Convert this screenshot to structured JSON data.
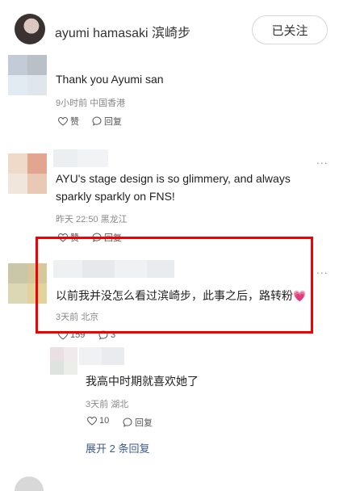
{
  "header": {
    "username": "ayumi hamasaki 滨崎步",
    "follow_label": "已关注"
  },
  "comments": [
    {
      "text": "Thank you Ayumi san",
      "time": "9小时前",
      "location": "中国香港",
      "like_label": "赞",
      "reply_label": "回复"
    },
    {
      "text": "AYU's stage design is so glimmery, and always sparkly sparkly on FNS!",
      "time": "昨天 22:50",
      "location": "黑龙江",
      "like_label": "赞",
      "reply_label": "回复",
      "more": "..."
    },
    {
      "text": "以前我并没怎么看过滨崎步，此事之后，路转粉",
      "emoji": "💗",
      "time": "3天前",
      "location": "北京",
      "like_count": "159",
      "reply_count": "3",
      "more": "..."
    }
  ],
  "reply": {
    "text": "我高中时期就喜欢她了",
    "time": "3天前",
    "location": "湖北",
    "like_count": "10",
    "reply_label": "回复"
  },
  "expand_label": "展开 2 条回复",
  "colors": {
    "highlight": "#f00000",
    "link": "#3b5a8a",
    "emoji_heart": "#e8456f"
  }
}
